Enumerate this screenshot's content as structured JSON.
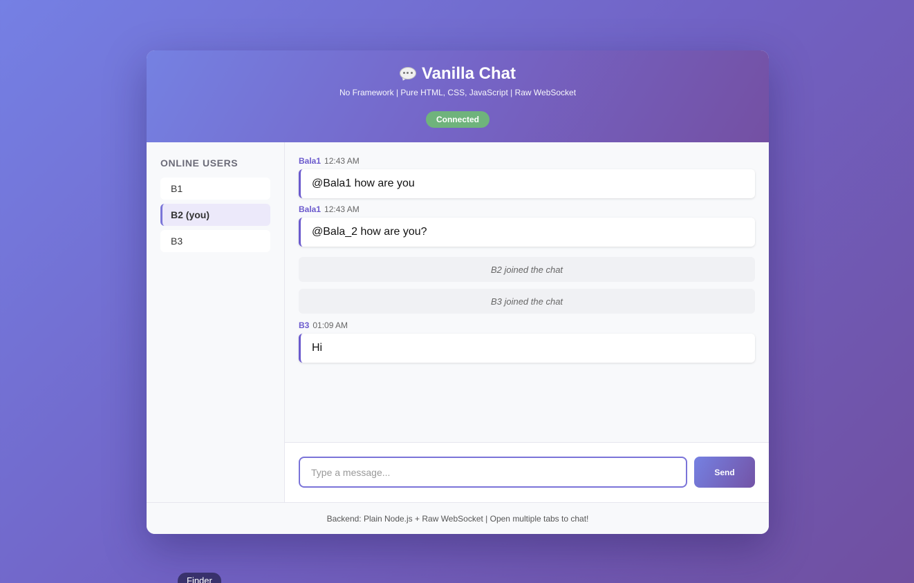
{
  "header": {
    "title": "Vanilla Chat",
    "subtitle": "No Framework | Pure HTML, CSS, JavaScript | Raw WebSocket",
    "status": "Connected",
    "icon": "speech-bubble-icon"
  },
  "sidebar": {
    "title": "ONLINE USERS",
    "users": [
      {
        "label": "B1"
      },
      {
        "label": "B2 (you)"
      },
      {
        "label": "B3"
      }
    ]
  },
  "messages": [
    {
      "user": "Bala1",
      "time": "12:43 AM",
      "text": "@Bala1 how are you"
    },
    {
      "user": "Bala1",
      "time": "12:43 AM",
      "text": "@Bala_2 how are you?"
    },
    {
      "system": "B2 joined the chat"
    },
    {
      "system": "B3 joined the chat"
    },
    {
      "user": "B3",
      "time": "01:09 AM",
      "text": "Hi"
    }
  ],
  "composer": {
    "placeholder": "Type a message...",
    "send_label": "Send"
  },
  "footer": {
    "text": "Backend: Plain Node.js + Raw WebSocket | Open multiple tabs to chat!"
  },
  "dock": {
    "label": "Finder"
  },
  "colors": {
    "accent": "#6b5acd",
    "connected": "#6fb37c"
  }
}
